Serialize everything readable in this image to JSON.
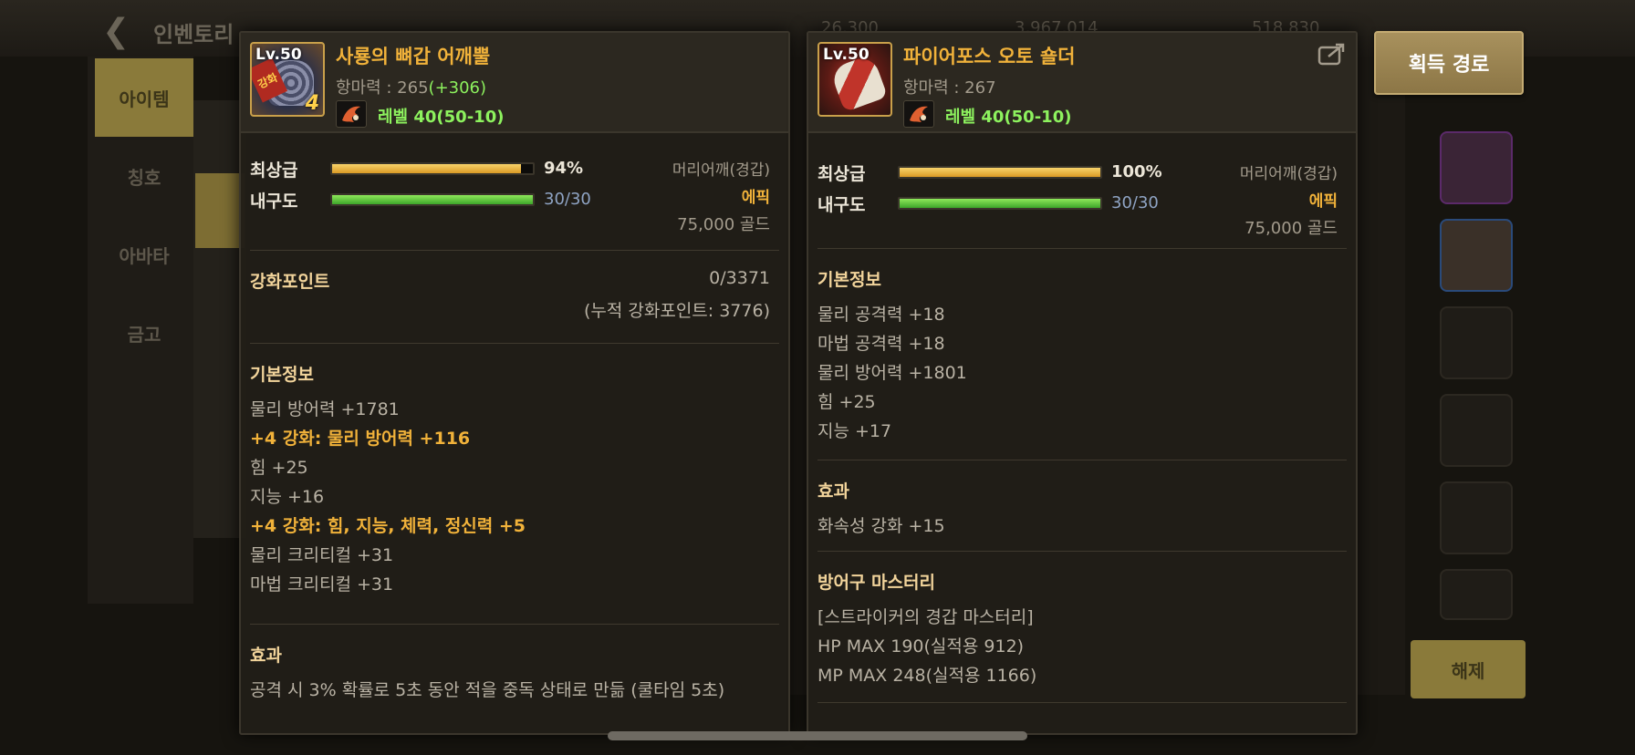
{
  "background": {
    "back_icon": "chevron-left-icon",
    "title": "인벤토리",
    "currency": [
      "26,300",
      "3,967,014",
      "518,830"
    ],
    "menu": [
      "아이템",
      "칭호",
      "아바타",
      "금고"
    ],
    "action_button": "해제"
  },
  "left_item": {
    "name": "사룡의 뼈갑 어깨뿔",
    "defense_label": "항마력 : 265",
    "defense_bonus": "(+306)",
    "level_text": "레벨 40(50-10)",
    "icon_level": "Lv.50",
    "icon_badge": "강화",
    "icon_enhance": "4",
    "quality_label": "최상급",
    "quality_percent": 94,
    "quality_text": "94%",
    "durability_label": "내구도",
    "durability_current": 30,
    "durability_max": 30,
    "durability_text": "30/30",
    "slot_type": "머리어깨(경갑)",
    "grade": "에픽",
    "price": "75,000 골드",
    "enhance_points_title": "강화포인트",
    "enhance_points_value": "0/3371",
    "enhance_points_total": "(누적 강화포인트: 3776)",
    "basic_info_title": "기본정보",
    "basic_stats": [
      {
        "text": "물리 방어력 +1781",
        "enhance": false
      },
      {
        "text": " +4 강화: 물리 방어력 +116",
        "enhance": true
      },
      {
        "text": "힘 +25",
        "enhance": false
      },
      {
        "text": "지능 +16",
        "enhance": false
      },
      {
        "text": " +4 강화: 힘, 지능, 체력, 정신력 +5",
        "enhance": true
      },
      {
        "text": "물리 크리티컬 +31",
        "enhance": false
      },
      {
        "text": "마법 크리티컬 +31",
        "enhance": false
      }
    ],
    "effect_title": "효과",
    "effect_text": "공격 시 3% 확률로 5초 동안 적을 중독 상태로 만듦 (쿨타임 5초)"
  },
  "right_item": {
    "name": "파이어포스 오토 숄더",
    "defense_label": "항마력 : 267",
    "level_text": "레벨 40(50-10)",
    "icon_level": "Lv.50",
    "quality_label": "최상급",
    "quality_percent": 100,
    "quality_text": "100%",
    "durability_label": "내구도",
    "durability_current": 30,
    "durability_max": 30,
    "durability_text": "30/30",
    "slot_type": "머리어깨(경갑)",
    "grade": "에픽",
    "price": "75,000 골드",
    "basic_info_title": "기본정보",
    "basic_stats": [
      "물리 공격력 +18",
      "마법 공격력 +18",
      "물리 방어력 +1801",
      "힘 +25",
      "지능 +17"
    ],
    "effect_title": "효과",
    "effect_text": "화속성 강화 +15",
    "mastery_title": "방어구 마스터리",
    "mastery_lines": [
      "[스트라이커의 경갑 마스터리]",
      "HP MAX 190(실적용 912)",
      "MP MAX 248(실적용 1166)"
    ]
  },
  "acquire_button": "획득 경로",
  "colors": {
    "item_name": "#f1b23a",
    "bonus_green": "#8df25e",
    "section_title": "#f2d49b",
    "enhance_text": "#f1b23a",
    "durability_blue": "#8fa4c4"
  }
}
